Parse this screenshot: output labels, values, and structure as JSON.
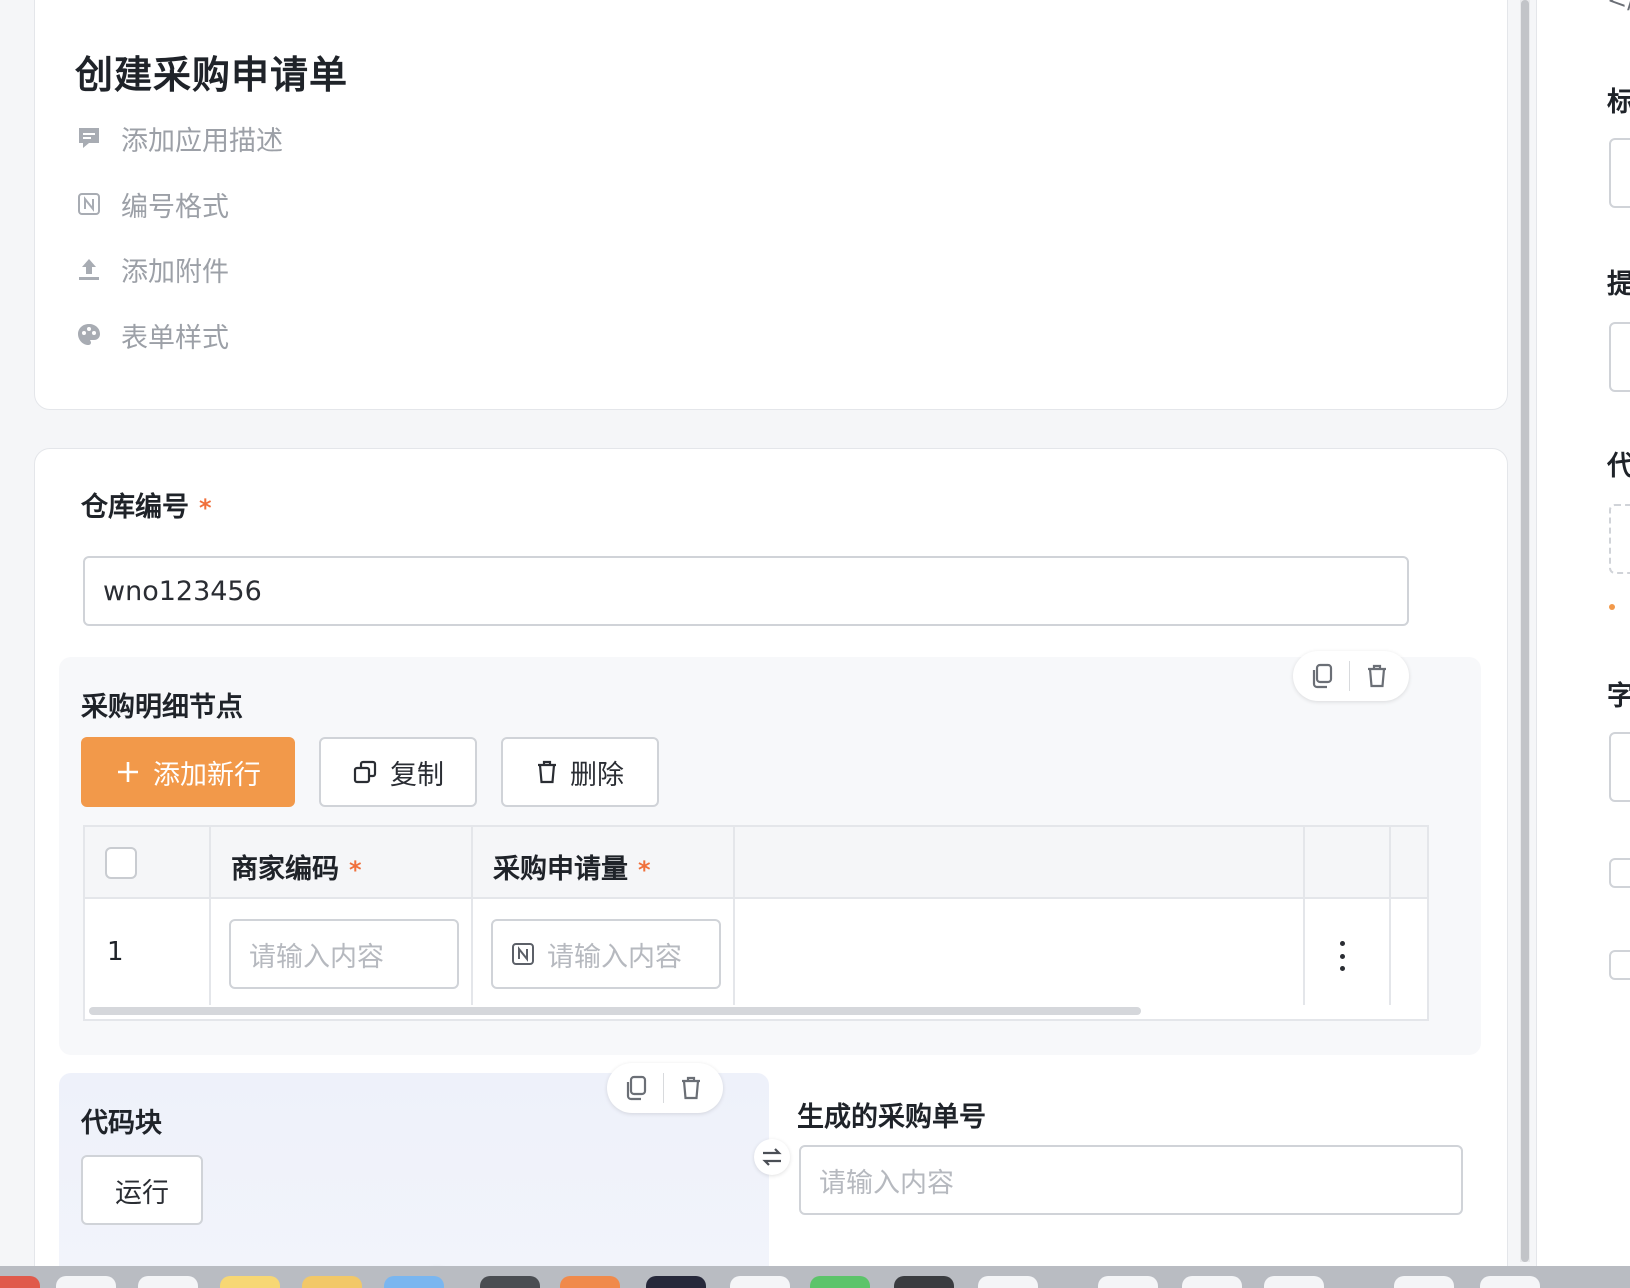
{
  "header": {
    "title": "创建采购申请单",
    "options": [
      {
        "label": "添加应用描述",
        "icon": "comment-icon"
      },
      {
        "label": "编号格式",
        "icon": "numbering-icon"
      },
      {
        "label": "添加附件",
        "icon": "upload-icon"
      },
      {
        "label": "表单样式",
        "icon": "palette-icon"
      }
    ]
  },
  "form": {
    "warehouse": {
      "label": "仓库编号",
      "required_mark": "*",
      "value": "wno123456"
    },
    "detail": {
      "title": "采购明细节点",
      "add_row_label": "添加新行",
      "copy_label": "复制",
      "delete_label": "删除",
      "columns": [
        {
          "label": "商家编码",
          "required_mark": "*"
        },
        {
          "label": "采购申请量",
          "required_mark": "*"
        }
      ],
      "rows": [
        {
          "index": "1",
          "merchant_code_placeholder": "请输入内容",
          "quantity_placeholder": "请输入内容"
        }
      ]
    },
    "code_block": {
      "title": "代码块",
      "run_label": "运行"
    },
    "generated_no": {
      "label": "生成的采购单号",
      "placeholder": "请输入内容"
    }
  },
  "right_panel": {
    "labels": [
      "标",
      "提",
      "代",
      "字"
    ]
  },
  "colors": {
    "primary": "#f2994a",
    "required": "#f0703c",
    "code_block_bg": "#eef1fa"
  }
}
